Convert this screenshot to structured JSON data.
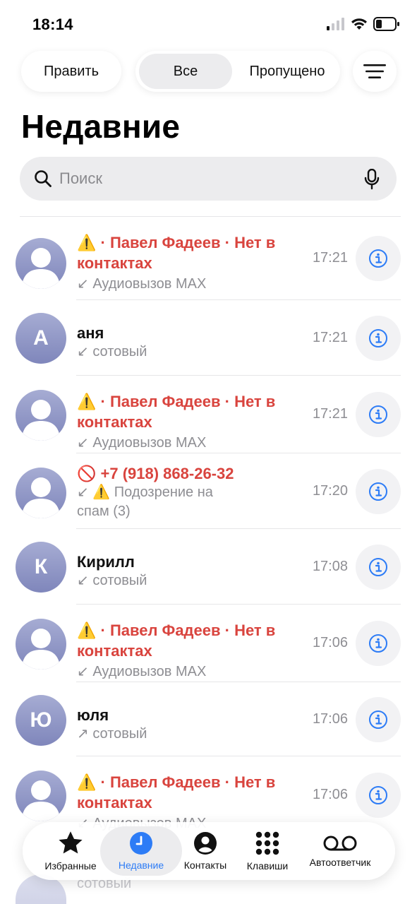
{
  "status": {
    "time": "18:14"
  },
  "header": {
    "edit_label": "Править",
    "segment_all": "Все",
    "segment_missed": "Пропущено",
    "filter_icon": "menu-lines-icon",
    "title": "Недавние"
  },
  "search": {
    "placeholder": "Поиск"
  },
  "calls": [
    {
      "avatar": "person",
      "name": "⚠️ · Павел Фадеев · Нет в контактах",
      "missed": true,
      "sub": "↙ Аудиовызов MAX",
      "time": "17:21"
    },
    {
      "avatar": "А",
      "name": "аня",
      "missed": false,
      "sub": "↙ сотовый",
      "time": "17:21"
    },
    {
      "avatar": "person",
      "name": "⚠️ · Павел Фадеев · Нет в контактах",
      "missed": true,
      "sub": "↙ Аудиовызов MAX",
      "time": "17:21"
    },
    {
      "avatar": "person",
      "name": "🚫 +7 (918) 868-26-32",
      "missed": true,
      "sub": "↙ ⚠️ Подозрение на спам (3)",
      "time": "17:20"
    },
    {
      "avatar": "К",
      "name": "Кирилл",
      "missed": false,
      "sub": "↙ сотовый",
      "time": "17:08"
    },
    {
      "avatar": "person",
      "name": "⚠️ · Павел Фадеев · Нет в контактах",
      "missed": true,
      "sub": "↙ Аудиовызов MAX",
      "time": "17:06"
    },
    {
      "avatar": "Ю",
      "name": "юля",
      "missed": false,
      "sub": "↗ сотовый",
      "time": "17:06"
    },
    {
      "avatar": "person",
      "name": "⚠️ · Павел Фадеев · Нет в контактах",
      "missed": true,
      "sub": "↙ Аудиовызов MAX",
      "time": "17:06"
    }
  ],
  "peek_row": {
    "sub": "сотовый"
  },
  "tabs": [
    {
      "label": "Избранные",
      "icon": "star-icon",
      "active": false
    },
    {
      "label": "Недавние",
      "icon": "clock-icon",
      "active": true
    },
    {
      "label": "Контакты",
      "icon": "person-circle-icon",
      "active": false
    },
    {
      "label": "Клавиши",
      "icon": "keypad-icon",
      "active": false
    },
    {
      "label": "Автоответчик",
      "icon": "voicemail-icon",
      "active": false
    }
  ],
  "colors": {
    "missed": "#d9443e",
    "accent": "#2d7cf6",
    "secondary": "#8e8e93"
  }
}
